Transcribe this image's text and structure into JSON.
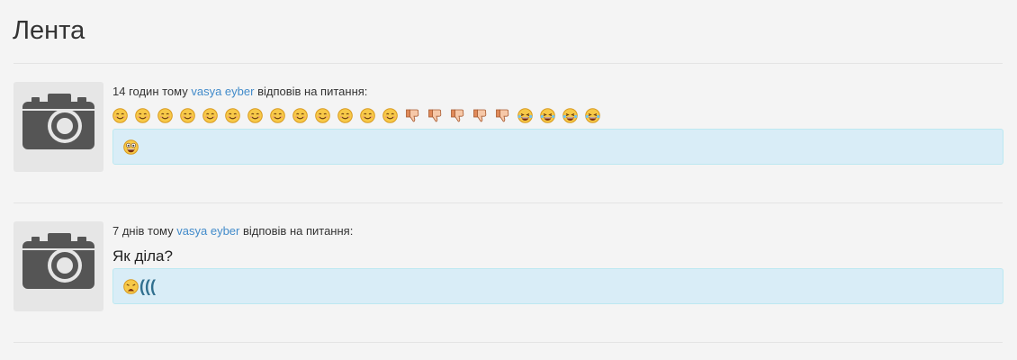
{
  "page": {
    "title": "Лента"
  },
  "feed": [
    {
      "time": "14 годин тому",
      "user": "vasya eyber",
      "action": "відповів на питання:",
      "question_icons": [
        "smile-icon",
        "smile-icon",
        "smile-icon",
        "smile-icon",
        "smile-icon",
        "smile-icon",
        "smile-icon",
        "smile-icon",
        "smile-icon",
        "smile-icon",
        "smile-icon",
        "smile-icon",
        "smile-icon",
        "thumbs-down-icon",
        "thumbs-down-icon",
        "thumbs-down-icon",
        "thumbs-down-icon",
        "thumbs-down-icon",
        "laughing-tears-icon",
        "laughing-tears-icon",
        "laughing-tears-icon",
        "laughing-tears-icon"
      ],
      "question_text": "",
      "answer_icon": "crazy-face-icon",
      "answer_text": ""
    },
    {
      "time": "7 днів тому",
      "user": "vasya eyber",
      "action": "відповів на питання:",
      "question_icons": [],
      "question_text": "Як діла?",
      "answer_icon": "weary-face-icon",
      "answer_text": "((("
    }
  ],
  "colors": {
    "link": "#428bca",
    "answer_bg": "#d9edf7",
    "answer_border": "#bce8f1",
    "page_bg": "#f4f4f4"
  }
}
